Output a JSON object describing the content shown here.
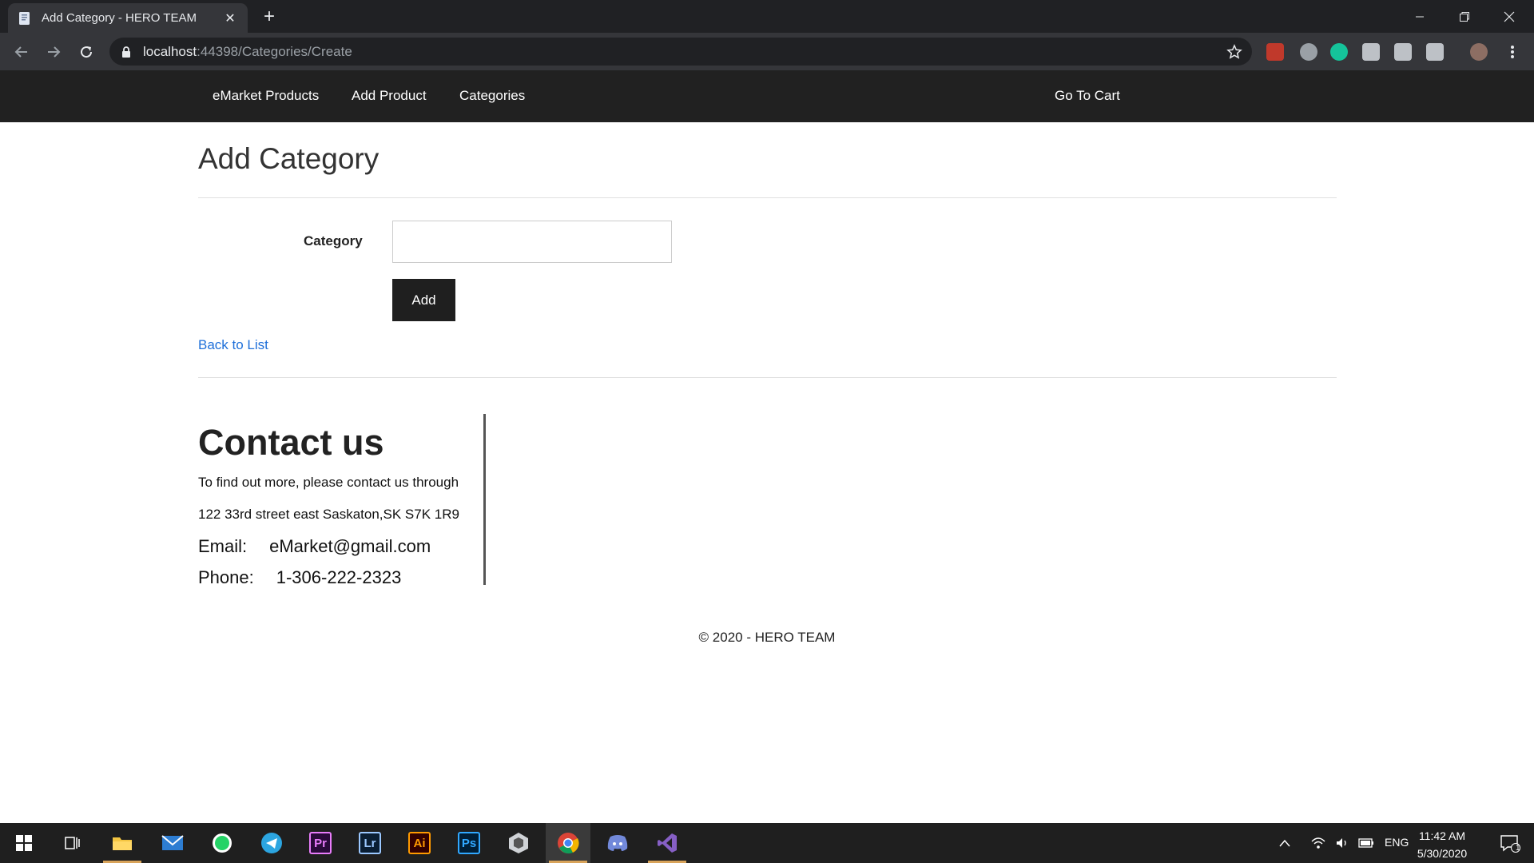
{
  "browser": {
    "tab_title": "Add Category - HERO TEAM",
    "tab_close": "✕",
    "new_tab": "+",
    "url_host": "localhost",
    "url_path": ":44398/Categories/Create"
  },
  "nav": {
    "items": [
      {
        "label": "eMarket Products"
      },
      {
        "label": "Add Product"
      },
      {
        "label": "Categories"
      }
    ],
    "cart": "Go To Cart"
  },
  "main": {
    "title": "Add Category",
    "field_label": "Category",
    "field_value": "",
    "add_button": "Add",
    "back_link": "Back to List"
  },
  "contact": {
    "title": "Contact us",
    "intro": "To find out more, please contact us through",
    "address": "122 33rd street east Saskaton,SK S7K 1R9",
    "email_label": "Email:",
    "email": "eMarket@gmail.com",
    "phone_label": "Phone:",
    "phone": "1-306-222-2323"
  },
  "footer": {
    "copyright": "© 2020 - HERO TEAM"
  },
  "taskbar": {
    "apps": [
      {
        "name": "Pr",
        "color": "#e87cfa",
        "bg": "#2a0a3a"
      },
      {
        "name": "Lr",
        "color": "#9bc8ff",
        "bg": "#0a1e33"
      },
      {
        "name": "Ai",
        "color": "#ff9a00",
        "bg": "#330000"
      },
      {
        "name": "Ps",
        "color": "#31a8ff",
        "bg": "#001e36"
      }
    ],
    "language": "ENG",
    "time": "11:42 AM",
    "date": "5/30/2020",
    "notification_count": "1"
  }
}
